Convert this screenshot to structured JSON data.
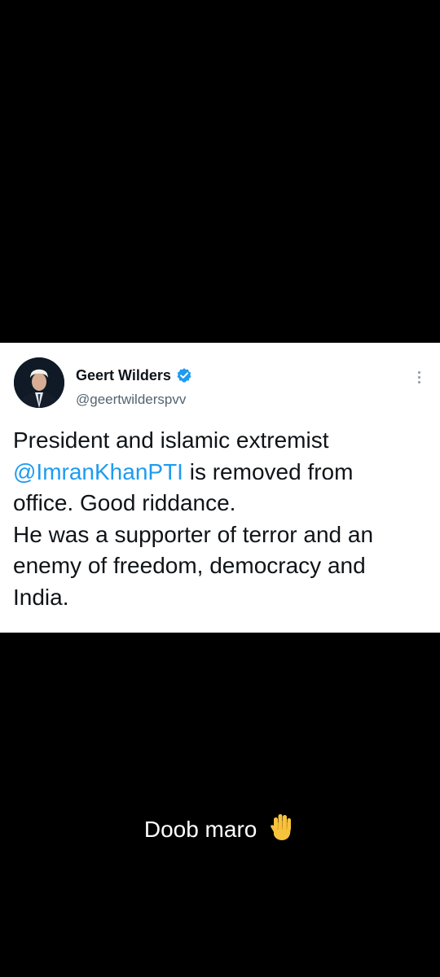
{
  "tweet": {
    "author_name": "Geert Wilders",
    "author_handle": "@geertwilderspvv",
    "verified": true,
    "text_line_1": "President and islamic extremist",
    "mention": "@ImranKhanPTI",
    "text_after_mention": " is removed from",
    "text_line_3": "office. Good riddance.",
    "text_line_4": "He was a supporter of terror and an",
    "text_line_5": "enemy of freedom, democracy and",
    "text_line_6": "India."
  },
  "caption": {
    "text": "Doob maro",
    "emoji_icon": "raised-hand-icon"
  },
  "colors": {
    "background": "#000000",
    "card": "#ffffff",
    "mention": "#1d9bf0",
    "verified": "#1d9bf0",
    "handle": "#536471"
  }
}
